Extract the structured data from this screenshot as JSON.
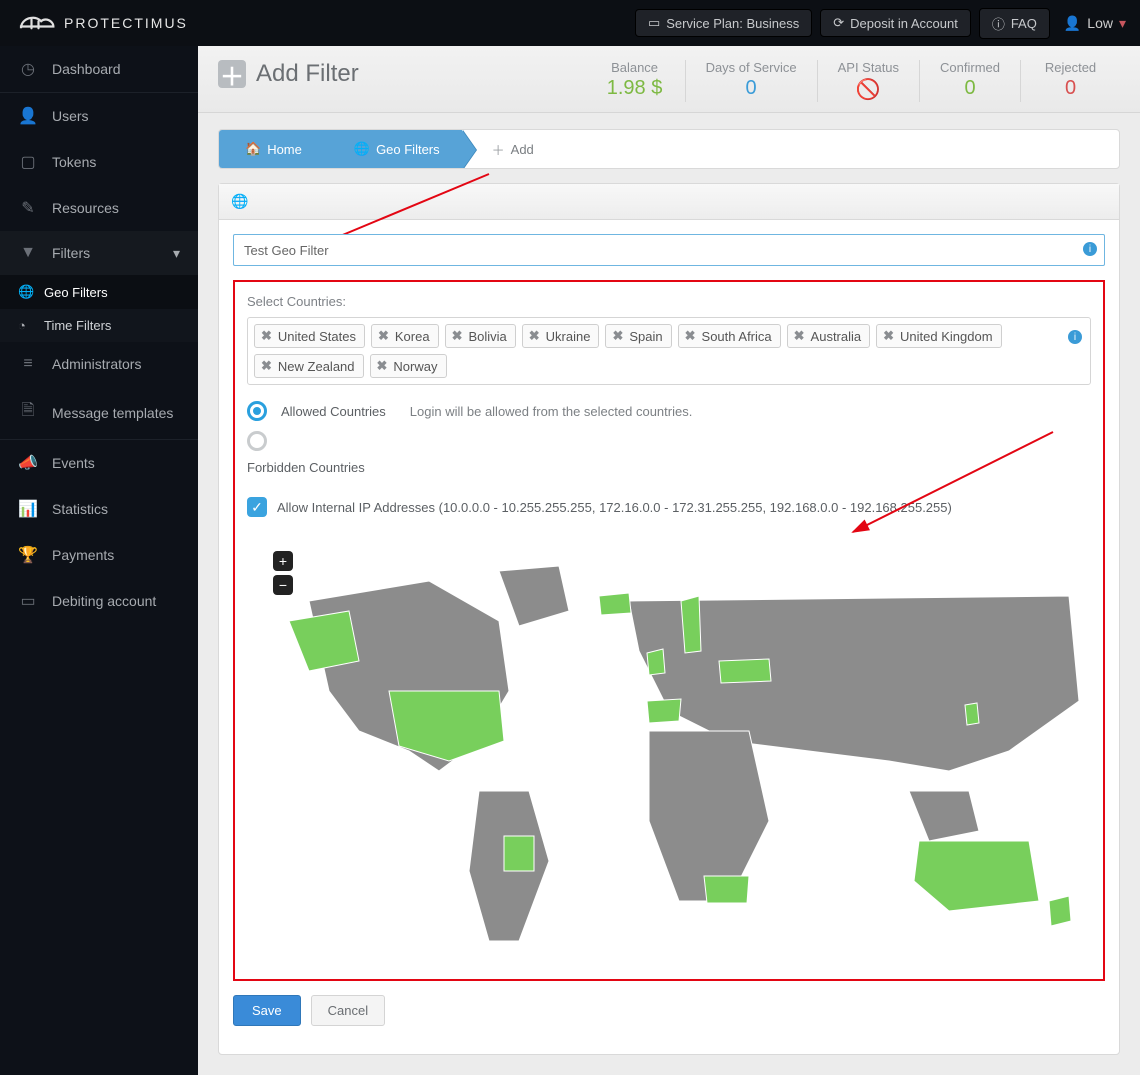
{
  "brand": "PROTECTIMUS",
  "topbar": {
    "service_plan": "Service Plan: Business",
    "deposit": "Deposit in Account",
    "faq": "FAQ",
    "user": "Low"
  },
  "sidebar": {
    "dashboard": "Dashboard",
    "users": "Users",
    "tokens": "Tokens",
    "resources": "Resources",
    "filters": "Filters",
    "geo_filters": "Geo Filters",
    "time_filters": "Time Filters",
    "administrators": "Administrators",
    "message_templates": "Message templates",
    "events": "Events",
    "statistics": "Statistics",
    "payments": "Payments",
    "debiting": "Debiting account"
  },
  "page": {
    "title": "Add Filter"
  },
  "stats": {
    "balance_label": "Balance",
    "balance_value": "1.98 $",
    "days_label": "Days of Service",
    "days_value": "0",
    "api_label": "API Status",
    "confirmed_label": "Confirmed",
    "confirmed_value": "0",
    "rejected_label": "Rejected",
    "rejected_value": "0"
  },
  "crumbs": {
    "home": "Home",
    "geo": "Geo Filters",
    "add": "Add"
  },
  "form": {
    "name_value": "Test Geo Filter",
    "select_countries_label": "Select Countries:",
    "countries": [
      "United States",
      "Korea",
      "Bolivia",
      "Ukraine",
      "Spain",
      "South Africa",
      "Australia",
      "United Kingdom",
      "New Zealand",
      "Norway"
    ],
    "allowed_label": "Allowed Countries",
    "allowed_help": "Login will be allowed from the selected countries.",
    "forbidden_label": "Forbidden Countries",
    "allow_internal_label": "Allow Internal IP Addresses (10.0.0.0 - 10.255.255.255, 172.16.0.0 - 172.31.255.255, 192.168.0.0 - 192.168.255.255)",
    "save": "Save",
    "cancel": "Cancel"
  }
}
